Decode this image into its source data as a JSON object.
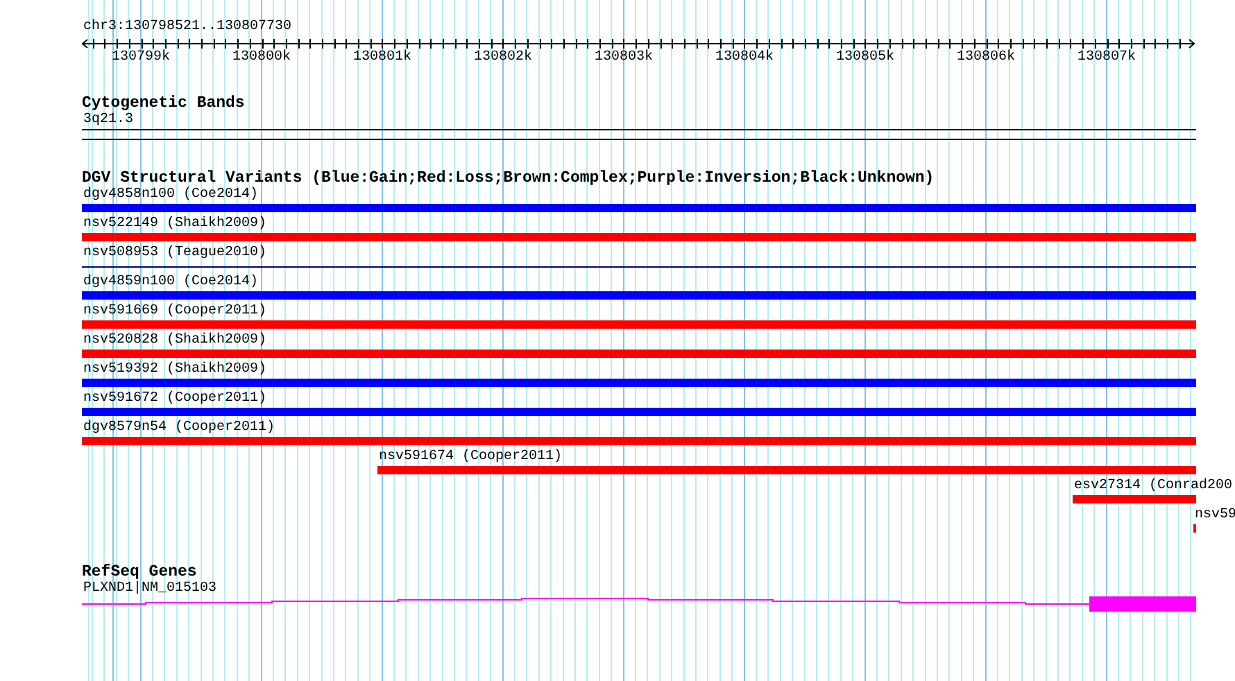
{
  "ruler": {
    "location": "chr3:130798521..130807730",
    "ticks": [
      "130799k",
      "130800k",
      "130801k",
      "130802k",
      "130803k",
      "130804k",
      "130805k",
      "130806k",
      "130807k"
    ]
  },
  "cytogenetic_bands": {
    "title": "Cytogenetic Bands",
    "band": "3q21.3"
  },
  "dgv_variants": {
    "title": "DGV Structural Variants (Blue:Gain;Red:Loss;Brown:Complex;Purple:Inversion;Black:Unknown)",
    "features": [
      {
        "label": "dgv4858n100 (Coe2014)",
        "kind": "bar",
        "color": "#0000ff"
      },
      {
        "label": "nsv522149 (Shaikh2009)",
        "kind": "bar",
        "color": "#ff0000"
      },
      {
        "label": "nsv508953 (Teague2010)",
        "kind": "line",
        "color": "#000080"
      },
      {
        "label": "dgv4859n100 (Coe2014)",
        "kind": "bar",
        "color": "#0000ff"
      },
      {
        "label": "nsv591669 (Cooper2011)",
        "kind": "bar",
        "color": "#ff0000"
      },
      {
        "label": "nsv520828 (Shaikh2009)",
        "kind": "bar",
        "color": "#ff0000"
      },
      {
        "label": "nsv519392 (Shaikh2009)",
        "kind": "bar",
        "color": "#0000ff"
      },
      {
        "label": "nsv591672 (Cooper2011)",
        "kind": "bar",
        "color": "#0000ff"
      },
      {
        "label": "dgv8579n54 (Cooper2011)",
        "kind": "bar",
        "color": "#ff0000"
      },
      {
        "label": "nsv591674 (Cooper2011)",
        "kind": "bar",
        "color": "#ff0000"
      },
      {
        "label": "esv27314 (Conrad200",
        "kind": "bar",
        "color": "#ff0000"
      },
      {
        "label": "nsv59",
        "kind": "bar",
        "color": "#ff0000"
      }
    ]
  },
  "refseq_genes": {
    "title": "RefSeq Genes",
    "gene": "PLXND1|NM_015103"
  }
}
